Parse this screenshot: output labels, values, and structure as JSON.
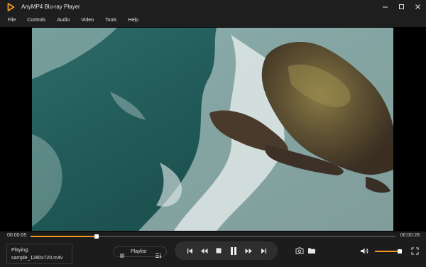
{
  "window": {
    "title": "AnyMP4 Blu-ray Player"
  },
  "menu": [
    "File",
    "Controls",
    "Audio",
    "Video",
    "Tools",
    "Help"
  ],
  "playback": {
    "current_time": "00:00:05",
    "total_time": "00:00:28",
    "progress": 0.18
  },
  "now_playing": {
    "label": "Playing:",
    "file": "sample_1280x720.m4v"
  },
  "playlist": {
    "label": "Playlist"
  },
  "volume": {
    "level": 0.92
  },
  "colors": {
    "accent": "#f39a1e",
    "background": "#1c1c1c",
    "titlebar": "#1e1e1e"
  },
  "icons": {
    "logo": "play-triangle-logo-icon",
    "minimize": "minimize-icon",
    "restore": "restore-icon",
    "close": "close-icon",
    "playlist_list": "list-icon",
    "playlist_sort": "sort-icon",
    "previous": "skip-previous-icon",
    "rewind": "rewind-icon",
    "stop": "stop-icon",
    "pause": "pause-icon",
    "fast_forward": "fast-forward-icon",
    "next": "skip-next-icon",
    "snapshot": "camera-icon",
    "open_folder": "folder-icon",
    "volume": "speaker-icon",
    "fullscreen": "fullscreen-icon"
  }
}
